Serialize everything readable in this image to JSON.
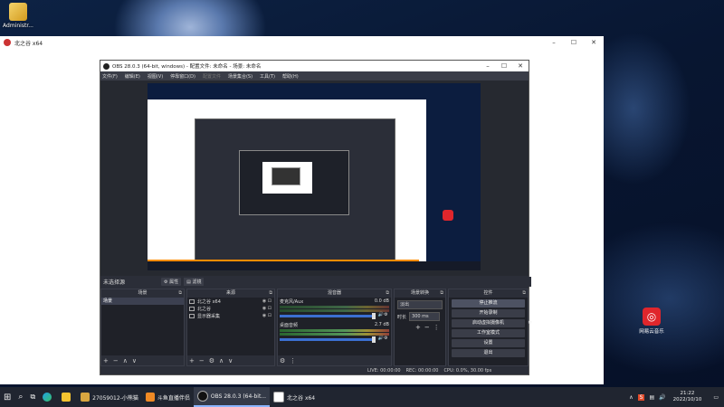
{
  "desktop": {
    "admin_icon_label": "Administr...",
    "netease_label": "网易云音乐"
  },
  "outer_window": {
    "title": "北之谷 x64"
  },
  "obs": {
    "title": "OBS 28.0.3 (64-bit, windows) - 配置文件: 未命名 - 场景: 未命名",
    "menu": [
      "文件(F)",
      "编辑(E)",
      "视图(V)",
      "停靠窗口(D)",
      "配置文件",
      "场景集合(S)",
      "工具(T)",
      "帮助(H)"
    ],
    "source_bar": {
      "label": "未选择源",
      "properties": "属性",
      "filters": "滤镜"
    },
    "docks": {
      "scenes": {
        "title": "场景",
        "items": [
          "场景"
        ]
      },
      "sources": {
        "title": "来源",
        "items": [
          "北之谷 x64",
          "北之谷",
          "显示器采集"
        ]
      },
      "mixer": {
        "title": "混音器",
        "channels": [
          {
            "name": "麦克风/Aux",
            "db": "0.0 dB"
          },
          {
            "name": "桌面音频",
            "db": "2.7 dB"
          }
        ]
      },
      "transitions": {
        "title": "场景转换",
        "type": "淡出",
        "duration_label": "时长",
        "duration_value": "300 ms"
      },
      "controls": {
        "title": "控件",
        "buttons": [
          "停止推流",
          "开始录制",
          "启动虚拟摄像机",
          "工作室模式",
          "设置",
          "退出"
        ]
      }
    },
    "status": {
      "live": "LIVE: 00:00:00",
      "rec": "REC: 00:00:00",
      "cpu": "CPU: 0.0%, 30.00 fps"
    }
  },
  "taskbar": {
    "items": [
      "27059012-小熊猫",
      "斗鱼直播伴侣",
      "OBS 28.0.3 (64-bit...",
      "北之谷 x64"
    ],
    "time": "21:22",
    "date": "2022/10/10"
  },
  "colors": {
    "obs_bg": "#2b2e38",
    "dock_bg": "#1f2128",
    "fader_blue": "#3b6fd1",
    "netease_red": "#e0262c",
    "orange_bar": "#ff8c00"
  }
}
